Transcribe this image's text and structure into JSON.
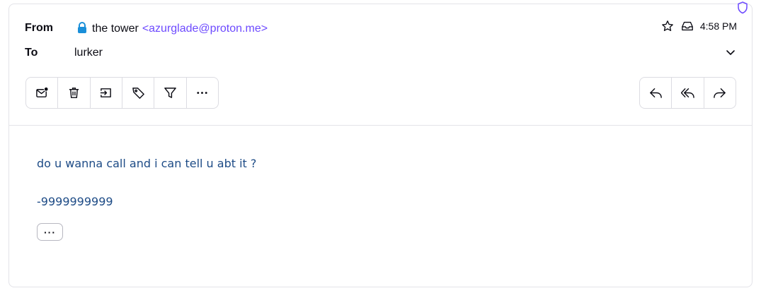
{
  "header": {
    "from_label": "From",
    "to_label": "To",
    "sender_name": "the tower",
    "sender_email": "<azurglade@proton.me>",
    "recipient": "lurker",
    "time": "4:58 PM"
  },
  "toolbar_left": {
    "items": [
      "mark-unread-icon",
      "trash-icon",
      "move-to-folder-icon",
      "label-tag-icon",
      "filter-icon",
      "more-icon"
    ]
  },
  "toolbar_right": {
    "items": [
      "reply-icon",
      "reply-all-icon",
      "forward-icon"
    ]
  },
  "message": {
    "line1": "do u wanna call and i can tell u abt it ?",
    "line2": "-9999999999",
    "expand_label": "···"
  },
  "colors": {
    "accent": "#6d4aff",
    "lock": "#1a8fd9",
    "body_text": "#1d4b86"
  }
}
